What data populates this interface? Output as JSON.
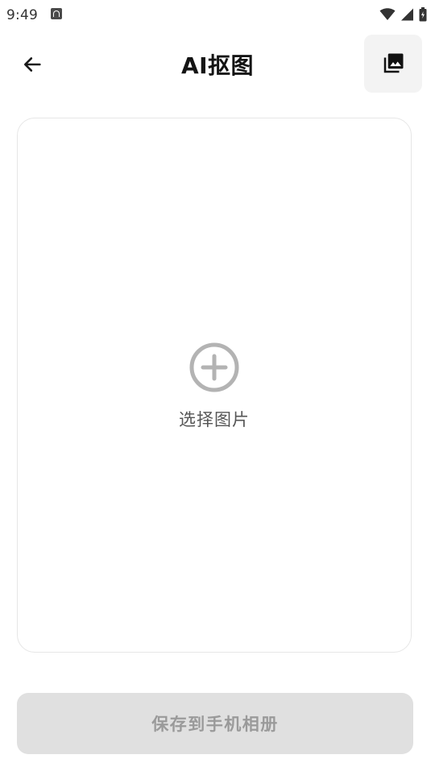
{
  "status_bar": {
    "time": "9:49",
    "icons": [
      "notification-a-icon",
      "wifi-icon",
      "signal-icon",
      "battery-icon"
    ]
  },
  "app_bar": {
    "title": "AI抠图",
    "back_icon": "arrow-left-icon",
    "gallery_icon": "photo-library-icon"
  },
  "picker": {
    "icon": "add-circle-icon",
    "label": "选择图片"
  },
  "actions": {
    "save_label": "保存到手机相册"
  },
  "colors": {
    "background": "#ffffff",
    "card_border": "#e6e6e6",
    "button_disabled_bg": "#e0e0e0",
    "button_disabled_text": "#9a9a9a",
    "gallery_button_bg": "#f3f3f3",
    "icon_gray": "#b0b0b0"
  }
}
